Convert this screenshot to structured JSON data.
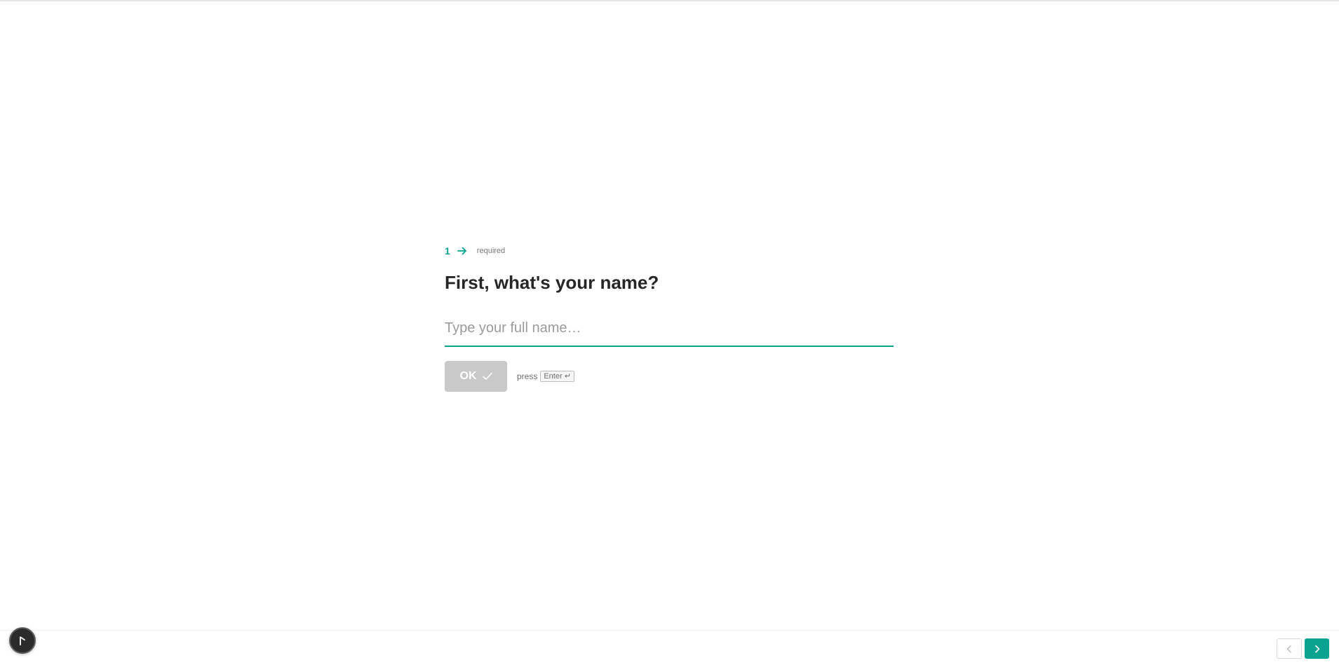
{
  "question": {
    "number": "1",
    "required_label": "required",
    "title": "First, what's your name?",
    "input_placeholder": "Type your full name…",
    "input_value": "",
    "ok_label": "OK",
    "press_label": "press",
    "enter_key_label": "Enter ↵"
  },
  "colors": {
    "accent": "#0aa291",
    "ok_button_disabled": "#c9c9c9",
    "title_text": "#262627"
  },
  "icons": {
    "question_arrow": "arrow-right-icon",
    "ok_check": "checkmark-icon",
    "nav_prev": "chevron-left-icon",
    "nav_next": "chevron-right-icon",
    "assist": "cursor-icon"
  }
}
